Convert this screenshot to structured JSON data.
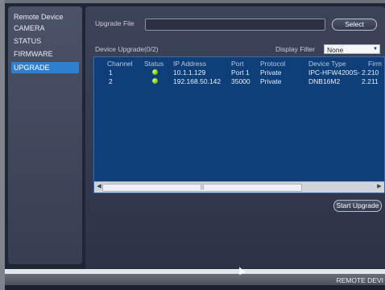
{
  "sidebar": {
    "items": [
      {
        "label": "Remote Device"
      },
      {
        "label": "CAMERA"
      },
      {
        "label": "STATUS"
      },
      {
        "label": "FIRMWARE"
      },
      {
        "label": "UPGRADE"
      }
    ]
  },
  "upgrade": {
    "file_label": "Upgrade File",
    "select_label": "Select",
    "device_upgrade_label": "Device Upgrade(0/2)",
    "display_filter_label": "Display Filter",
    "display_filter_value": "None",
    "start_upgrade_label": "Start Upgrade"
  },
  "table": {
    "headers": [
      "Channel",
      "Status",
      "IP Address",
      "Port",
      "Protocol",
      "Device Type",
      "Firm"
    ],
    "rows": [
      {
        "channel": "1",
        "ip": "10.1.1.129",
        "port": "Port 1",
        "protocol": "Private",
        "device_type": "IPC-HFW4200S-",
        "firm": "2.210"
      },
      {
        "channel": "2",
        "ip": "192.168.50.142",
        "port": "35000",
        "protocol": "Private",
        "device_type": "DNB16M2",
        "firm": "2.211"
      }
    ]
  },
  "taskbar": {
    "text": "REMOTE DEVI"
  },
  "colors": {
    "status_ok": "#7fc313",
    "accent": "#2f7fd1",
    "table_bg": "#0f3f79"
  }
}
